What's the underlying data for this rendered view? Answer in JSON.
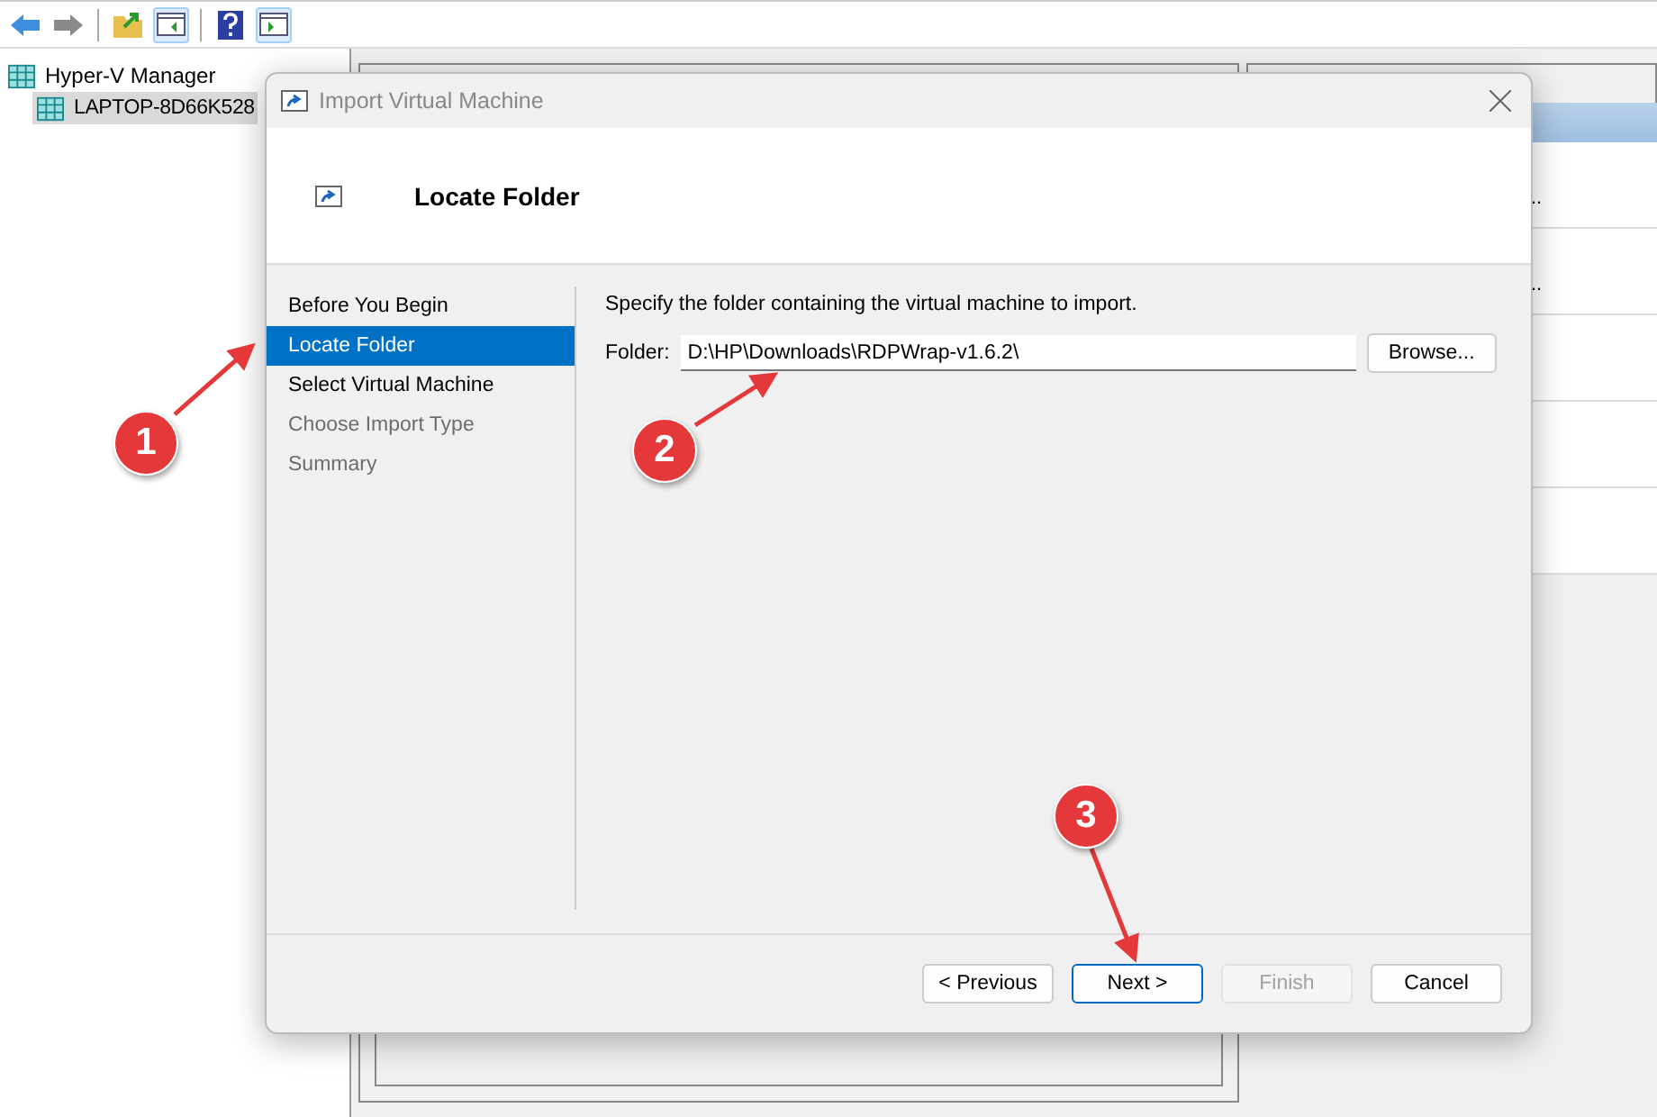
{
  "tree": {
    "root": "Hyper-V Manager",
    "children": [
      {
        "label": "LAPTOP-8D66K528",
        "selected": true
      }
    ]
  },
  "actions": {
    "items": [
      "..",
      ".."
    ]
  },
  "dialog": {
    "title": "Import Virtual Machine",
    "heading": "Locate Folder",
    "steps": [
      {
        "label": "Before You Begin",
        "selected": false,
        "disabled": false
      },
      {
        "label": "Locate Folder",
        "selected": true,
        "disabled": false
      },
      {
        "label": "Select Virtual Machine",
        "selected": false,
        "disabled": false
      },
      {
        "label": "Choose Import Type",
        "selected": false,
        "disabled": true
      },
      {
        "label": "Summary",
        "selected": false,
        "disabled": true
      }
    ],
    "instruction": "Specify the folder containing the virtual machine to import.",
    "folder": {
      "label": "Folder:",
      "value": "D:\\HP\\Downloads\\RDPWrap-v1.6.2\\"
    },
    "browse": "Browse...",
    "buttons": [
      {
        "label": "< Previous",
        "default": false,
        "disabled": false
      },
      {
        "label": "Next >",
        "default": true,
        "disabled": false
      },
      {
        "label": "Finish",
        "default": false,
        "disabled": true
      },
      {
        "label": "Cancel",
        "default": false,
        "disabled": false
      }
    ]
  },
  "annotations": [
    {
      "label": "1"
    },
    {
      "label": "2"
    },
    {
      "label": "3"
    }
  ]
}
